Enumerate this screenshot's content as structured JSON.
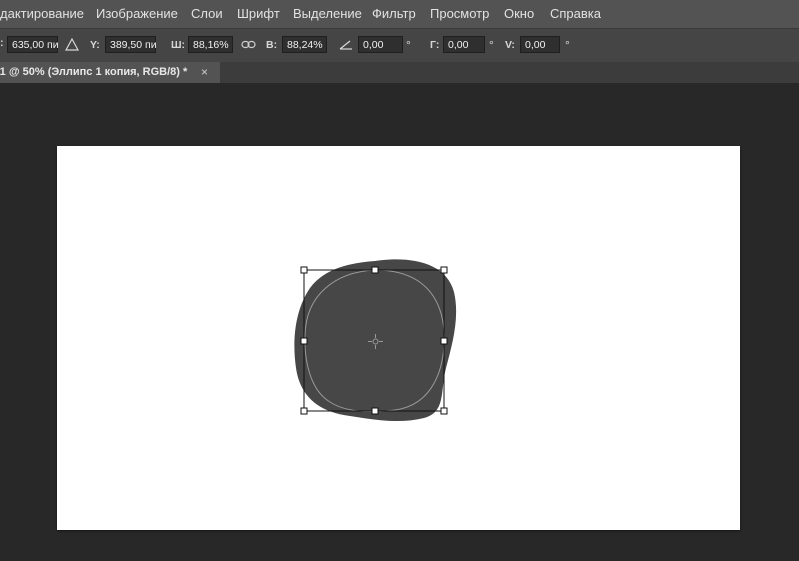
{
  "menu": {
    "items": [
      "дактирование",
      "Изображение",
      "Слои",
      "Шрифт",
      "Выделение",
      "Фильтр",
      "Просмотр",
      "Окно",
      "Справка"
    ]
  },
  "options": {
    "x_value": "635,00 пи",
    "y_label": "Y:",
    "y_value": "389,50 пи",
    "w_label": "Ш:",
    "w_value": "88,16%",
    "h_label": "В:",
    "h_value": "88,24%",
    "angle_value": "0,00",
    "angle_unit": "°",
    "hskew_label": "Г:",
    "hskew_value": "0,00",
    "hskew_unit": "°",
    "vskew_label": "V:",
    "vskew_value": "0,00",
    "vskew_unit": "°",
    "icons": [
      "reference-point-triangle-icon",
      "link-icon",
      "angle-icon"
    ]
  },
  "document": {
    "tab_title": "-1 @ 50% (Эллипс 1 копия, RGB/8) *",
    "tab_close": "×"
  },
  "colors": {
    "menubar_bg": "#535353",
    "workspace_bg": "#282828",
    "shape_fill": "#474747",
    "canvas_bg": "#ffffff"
  }
}
